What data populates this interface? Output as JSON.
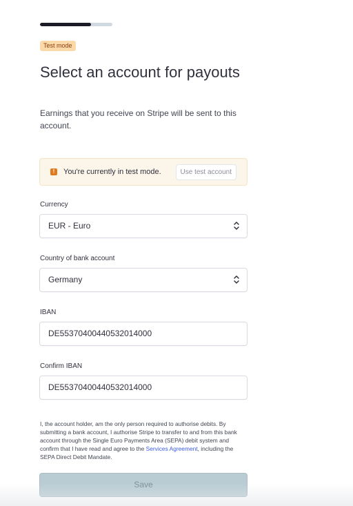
{
  "progress": {
    "fraction": 0.7
  },
  "badge": {
    "label": "Test mode"
  },
  "header": {
    "title": "Select an account for payouts",
    "subtitle": "Earnings that you receive on Stripe will be sent to this account."
  },
  "notice": {
    "text": "You're currently in test mode.",
    "button_label": "Use test account",
    "icon": "info-icon",
    "icon_glyph": "!"
  },
  "currency": {
    "label": "Currency",
    "value": "EUR - Euro"
  },
  "country": {
    "label": "Country of bank account",
    "value": "Germany"
  },
  "iban": {
    "label": "IBAN",
    "value": "DE55370400440532014000"
  },
  "confirm_iban": {
    "label": "Confirm IBAN",
    "value": "DE55370400440532014000"
  },
  "consent": {
    "text_before": "I, the account holder, am the only person required to authorise debits. By submitting a bank account, I authorise Stripe to transfer to and from this bank account through the Single Euro Payments Area (SEPA) debit system and confirm that I have read and agree to the ",
    "link_text": "Services Agreement",
    "text_after": ", including the SEPA Direct Debit Mandate."
  },
  "save": {
    "label": "Save"
  },
  "colors": {
    "accent_link": "#3a5ce8",
    "badge_bg": "#fcd9a8",
    "notice_bg": "#fcf5e9",
    "save_disabled_bg": "#b9ccd4"
  }
}
